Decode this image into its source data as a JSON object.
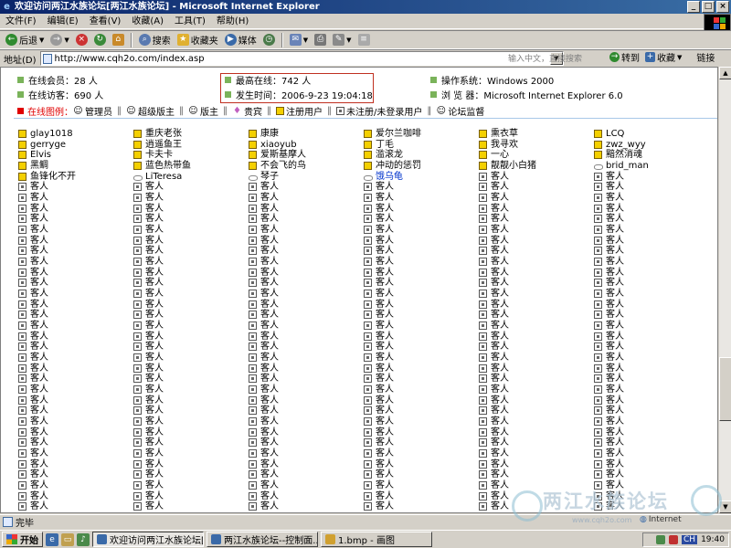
{
  "window": {
    "title": "欢迎访问两江水族论坛[两江水族论坛] - Microsoft Internet Explorer"
  },
  "menu": [
    "文件(F)",
    "编辑(E)",
    "查看(V)",
    "收藏(A)",
    "工具(T)",
    "帮助(H)"
  ],
  "toolbar": {
    "back": "后退",
    "search": "搜索",
    "favorites": "收藏夹",
    "media": "媒体"
  },
  "address": {
    "label": "地址(D)",
    "url": "http://www.cqh2o.com/index.asp",
    "search_placeholder": "输入中文，直接搜索",
    "go": "转到",
    "favorites": "收藏",
    "links": "链接"
  },
  "stats": {
    "members": "在线会员：28 人",
    "guests": "在线访客：690 人",
    "max_online": "最高在线：742 人",
    "max_time": "发生时间：2006-9-23 19:04:18",
    "os": "操作系统：Windows 2000",
    "browser": "浏 览 器：Microsoft Internet Explorer 6.0"
  },
  "legend": {
    "title": "在线图例：",
    "items": [
      "管理员",
      "超级版主",
      "版主",
      "贵宾",
      "注册用户",
      "未注册/未登录用户",
      "论坛监督"
    ]
  },
  "users": {
    "guest_label": "客人",
    "guest_rows": 31,
    "rows": [
      [
        {
          "name": "glay1018",
          "type": "user"
        },
        {
          "name": "重庆老张",
          "type": "user"
        },
        {
          "name": "康康",
          "type": "user"
        },
        {
          "name": "爱尔兰咖啡",
          "type": "user"
        },
        {
          "name": "熏衣草",
          "type": "user"
        },
        {
          "name": "LCQ",
          "type": "user"
        }
      ],
      [
        {
          "name": "gerryge",
          "type": "user"
        },
        {
          "name": "逍遥鱼王",
          "type": "user"
        },
        {
          "name": "xiaoyub",
          "type": "user"
        },
        {
          "name": "丁毛",
          "type": "user"
        },
        {
          "name": "我寻欢",
          "type": "user"
        },
        {
          "name": "zwz_wyy",
          "type": "user"
        }
      ],
      [
        {
          "name": "Elvis",
          "type": "user"
        },
        {
          "name": "卡夫卡",
          "type": "user"
        },
        {
          "name": "爱斯基摩人",
          "type": "user"
        },
        {
          "name": "滥滚龙",
          "type": "user"
        },
        {
          "name": "一心",
          "type": "user"
        },
        {
          "name": "黯然消魂",
          "type": "user"
        }
      ],
      [
        {
          "name": "黑鲷",
          "type": "user"
        },
        {
          "name": "蓝色热带鱼",
          "type": "user"
        },
        {
          "name": "不会飞的鸟",
          "type": "user"
        },
        {
          "name": "冲动的惩罚",
          "type": "user"
        },
        {
          "name": "靓靓小白猪",
          "type": "user"
        },
        {
          "name": "brid_man",
          "type": "unreg"
        }
      ],
      [
        {
          "name": "鱼锋化不开",
          "type": "user"
        },
        {
          "name": "LiTeresa",
          "type": "unreg"
        },
        {
          "name": "琴子",
          "type": "unreg"
        },
        {
          "name": "饿乌龟",
          "type": "unreg",
          "blue": true
        },
        {
          "name": "客人",
          "type": "guest"
        },
        {
          "name": "客人",
          "type": "guest"
        }
      ]
    ]
  },
  "status": {
    "text": "完毕",
    "zone": "Internet"
  },
  "watermark": {
    "text": "两江水族论坛",
    "url": "www.cqh2o.com"
  },
  "taskbar": {
    "start": "开始",
    "tasks": [
      "欢迎访问两江水族论坛[...",
      "两江水族论坛--控制面...",
      "1.bmp - 画图"
    ],
    "ime": "CH",
    "clock": "19:40"
  },
  "colors": {
    "title_start": "#0a246a",
    "title_end": "#3a6ea5",
    "stat_bullet": "#7ab35a",
    "legend_title": "#e00000",
    "highlight_border": "#c03020"
  }
}
